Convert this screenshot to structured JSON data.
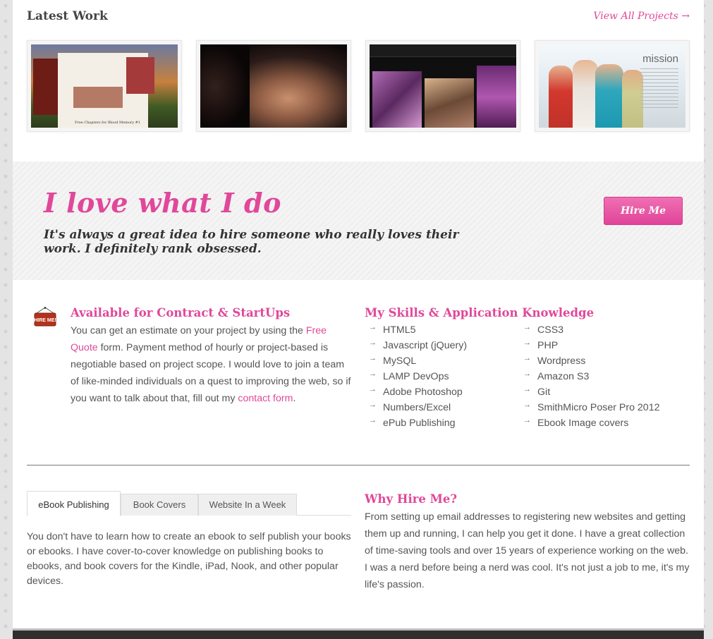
{
  "latest_work": {
    "title": "Latest Work",
    "view_all": "View All Projects →",
    "thumb1_caption": "Free Chapters for Blood Memory #1",
    "thumb4_caption": "mission"
  },
  "hero": {
    "title": "I love what I do",
    "subtitle": "It's always a great idea to hire someone who really loves their work. I definitely rank obsessed.",
    "button": "Hire Me"
  },
  "contract": {
    "sign": "HIRE ME!",
    "heading": "Available for Contract & StartUps",
    "text_1": "You can get an estimate on your project by using the ",
    "link_1": "Free Quote",
    "text_2": " form. Payment method of hourly or project-based is negotiable based on project scope. I would love to join a team of like-minded individuals on a quest to improving the web, so if you want to talk about that, fill out my ",
    "link_2": "contact form",
    "text_3": "."
  },
  "skills": {
    "heading": "My Skills & Application Knowledge",
    "bullet": "→",
    "col1": [
      "HTML5",
      "Javascript (jQuery)",
      "MySQL",
      "LAMP DevOps",
      "Adobe Photoshop",
      "Numbers/Excel",
      "ePub Publishing"
    ],
    "col2": [
      "CSS3",
      "PHP",
      "Wordpress",
      "Amazon S3",
      "Git",
      "SmithMicro Poser Pro 2012",
      "Ebook Image covers"
    ]
  },
  "tabs": {
    "items": [
      "eBook Publishing",
      "Book Covers",
      "Website In a Week"
    ],
    "active_body": "You don't have to learn how to create an ebook to self publish your books or ebooks. I have cover-to-cover knowledge on publishing books to ebooks, and book covers for the Kindle, iPad, Nook, and other popular devices."
  },
  "why": {
    "heading": "Why Hire Me?",
    "text": "From setting up email addresses to registering new websites and getting them up and running, I can help you get it done. I have a great collection of time-saving tools and over 15 years of experience working on the web. I was a nerd before being a nerd was cool. It's not just a job to me, it's my life's passion."
  },
  "colors": {
    "accent": "#e0489a",
    "text": "#555555",
    "footer": "#2f2f2f"
  }
}
